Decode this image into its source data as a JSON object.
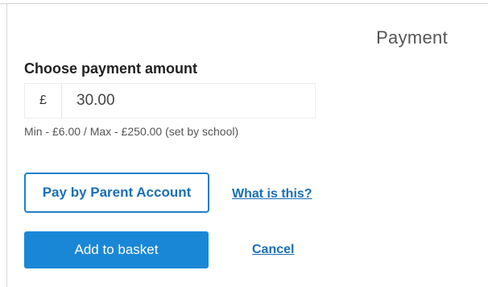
{
  "panel": {
    "title": "Payment"
  },
  "amount": {
    "heading": "Choose payment amount",
    "currency_symbol": "£",
    "value": "30.00",
    "help_text": "Min - £6.00 / Max - £250.00 (set by school)"
  },
  "actions": {
    "parent_account_label": "Pay by Parent Account",
    "what_is_this_label": "What is this?",
    "add_to_basket_label": "Add to basket",
    "cancel_label": "Cancel"
  },
  "colors": {
    "primary": "#1a87d6",
    "link": "#1a6fb5",
    "outline_border": "#1f7fc9"
  }
}
